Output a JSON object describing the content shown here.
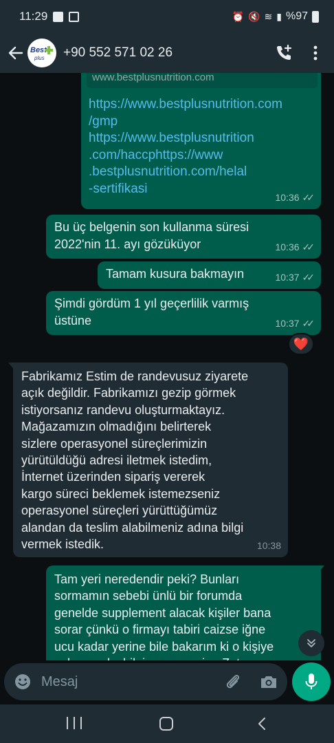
{
  "status_bar": {
    "time": "11:29",
    "battery": "%97",
    "alarm_symbol": "⏰",
    "mute_symbol": "🔇",
    "wifi_symbol": "≋",
    "signal_symbol": "▮"
  },
  "header": {
    "contact": "+90 552 571 02 26",
    "avatar_text": "Best Plus"
  },
  "messages": {
    "m1": {
      "preview_domain": "www.bestplusnutrition.com",
      "links": "https://www.bestplusnutrition.com\n/gmp\nhttps://www.bestplusnutrition\n.com/haccphttps://www\n.bestplusnutrition.com/helal\n-sertifikasi",
      "time": "10:36"
    },
    "m2": {
      "text": "Bu üç belgenin son kullanma süresi\n2022'nin 11. ayı gözüküyor",
      "time": "10:36"
    },
    "m3": {
      "text": "Tamam kusura bakmayın",
      "time": "10:37"
    },
    "m4": {
      "text": "Şimdi gördüm 1 yıl geçerlilik varmış\nüstüne",
      "time": "10:37",
      "reaction": "❤️"
    },
    "m5": {
      "text": "Fabrikamız Estim de randevusuz ziyarete\naçık değildir. Fabrikamızı gezip görmek\nistiyorsanız randevu oluşturmaktayız.\nMağazamızın olmadığını belirterek\nsizlere operasyonel süreçlerimizin\nyürütüldüğü adresi iletmek istedim,\nİnternet üzerinden sipariş vererek\nkargo süreci beklemek istemezseniz\noperasyonel süreçleri yürüttüğümüz\nalandan da teslim alabilmeniz adına bilgi\nvermek istedik.",
      "time": "10:38"
    },
    "m6": {
      "text": "Tam yeri neredendir peki? Bunları\nsormamın sebebi ünlü bir forumda\ngenelde supplement alacak kişiler bana\nsorar çünkü o firmayı tabiri caizse iğne\nucu kadar yerine bile bakarım ki o kişiye\nyalan yanlış bilgi vermeyeyim. Zaten"
    }
  },
  "input": {
    "placeholder": "Mesaj"
  },
  "colors": {
    "outgoing_bubble": "#005c4b",
    "incoming_bubble": "#202c33",
    "background": "#0b0f12",
    "accent": "#00a884",
    "link": "#53bdeb"
  }
}
